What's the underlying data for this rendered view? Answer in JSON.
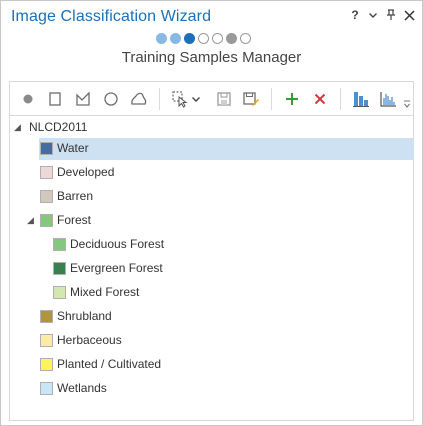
{
  "window": {
    "title": "Image Classification Wizard",
    "controls": {
      "help": "?",
      "menu": "⌄",
      "pin": "⊓",
      "close": "✕"
    }
  },
  "wizard": {
    "steps": [
      "done",
      "done",
      "current",
      "pending",
      "pending",
      "gray",
      "pending"
    ],
    "page_title": "Training Samples Manager"
  },
  "toolbar": {
    "tools": [
      "point-tool-icon",
      "rectangle-tool-icon",
      "polygon-tool-icon",
      "circle-tool-icon",
      "freehand-tool-icon",
      "select-tool-icon",
      "save-icon",
      "save-as-icon",
      "add-class-icon",
      "remove-class-icon",
      "collapse-icon",
      "histogram-icon"
    ]
  },
  "tree": {
    "root": "NLCD2011",
    "items": [
      {
        "label": "Water",
        "color": "#476ba1",
        "level": 1,
        "selected": true
      },
      {
        "label": "Developed",
        "color": "#eed7d7",
        "level": 1
      },
      {
        "label": "Barren",
        "color": "#d2c8bc",
        "level": 1
      },
      {
        "label": "Forest",
        "color": "#85c77e",
        "level": 1,
        "expanded": true
      },
      {
        "label": "Deciduous Forest",
        "color": "#85c77e",
        "level": 2
      },
      {
        "label": "Evergreen Forest",
        "color": "#38814e",
        "level": 2
      },
      {
        "label": "Mixed Forest",
        "color": "#d4e7b0",
        "level": 2
      },
      {
        "label": "Shrubland",
        "color": "#af963c",
        "level": 1
      },
      {
        "label": "Herbaceous",
        "color": "#fbeba7",
        "level": 1
      },
      {
        "label": "Planted / Cultivated",
        "color": "#fbf655",
        "level": 1
      },
      {
        "label": "Wetlands",
        "color": "#c8e6f8",
        "level": 1
      }
    ]
  },
  "colors": {
    "accent": "#1d6fb8",
    "selection": "#cde1f3"
  }
}
